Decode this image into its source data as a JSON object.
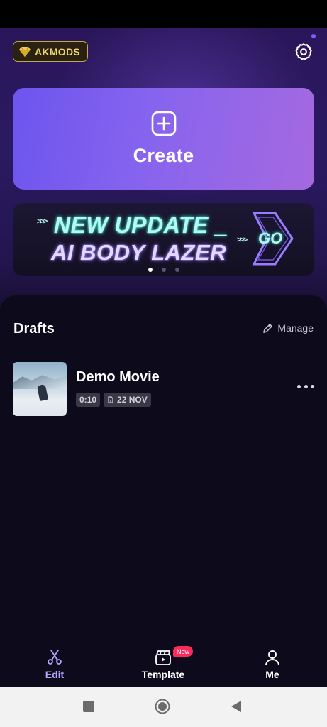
{
  "header": {
    "badge_label": "AKMODS",
    "badge_icon": "gem-icon",
    "settings_icon": "gear-icon"
  },
  "create": {
    "label": "Create",
    "icon": "plus-square-icon"
  },
  "banner": {
    "line1": "NEW UPDATE _",
    "line2": "AI BODY LAZER",
    "cta": "GO",
    "carousel_total": 3,
    "carousel_active": 1
  },
  "drafts": {
    "title": "Drafts",
    "manage_label": "Manage",
    "items": [
      {
        "name": "Demo Movie",
        "duration": "0:10",
        "date": "22 NOV"
      }
    ]
  },
  "bottom_nav": {
    "items": [
      {
        "label": "Edit",
        "icon": "scissors-icon",
        "active": true
      },
      {
        "label": "Template",
        "icon": "clapper-icon",
        "badge": "New"
      },
      {
        "label": "Me",
        "icon": "person-icon"
      }
    ]
  },
  "colors": {
    "accent": "#b3a4ff",
    "create_gradient_start": "#6c55ee",
    "create_gradient_end": "#a569e0",
    "badge_gold": "#f1d36a",
    "new_badge": "#ff2a5c",
    "panel_bg": "#0d0b1b"
  }
}
